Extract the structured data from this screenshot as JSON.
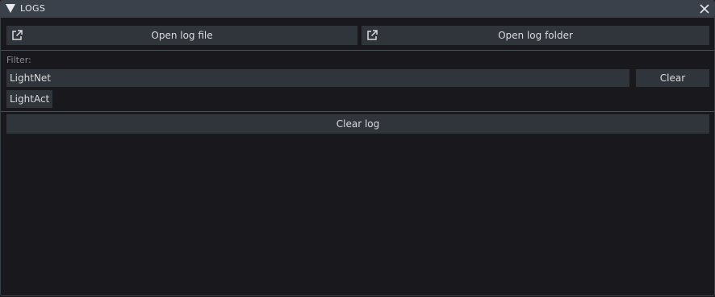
{
  "window": {
    "title": "LOGS",
    "collapse_icon": "triangle-down-icon",
    "close_icon": "close-icon"
  },
  "actions": {
    "open_file_label": "Open log file",
    "open_folder_label": "Open log folder",
    "external_icon": "external-link-icon"
  },
  "filter": {
    "label": "Filter:",
    "value": "LightNet",
    "clear_label": "Clear",
    "tags": [
      "LightAct"
    ]
  },
  "log": {
    "clear_label": "Clear log",
    "entries": []
  },
  "colors": {
    "background": "#18181d",
    "titlebar": "#3b414a",
    "button": "#30343b",
    "text": "#dcdcdf",
    "muted_text": "#8b8d93"
  }
}
